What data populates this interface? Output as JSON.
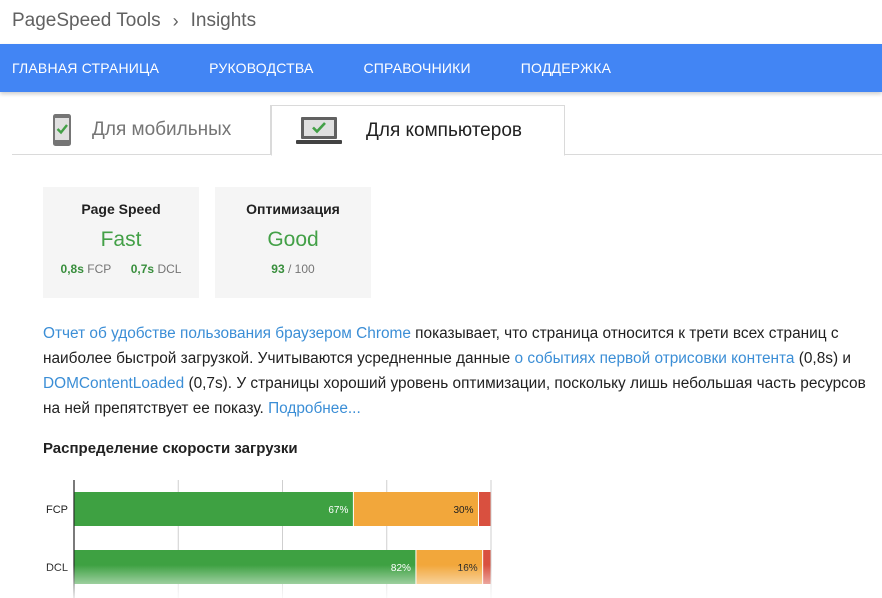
{
  "breadcrumb": {
    "root": "PageSpeed Tools",
    "current": "Insights"
  },
  "nav": {
    "items": [
      {
        "label": "ГЛАВНАЯ СТРАНИЦА"
      },
      {
        "label": "РУКОВОДСТВА"
      },
      {
        "label": "СПРАВОЧНИКИ"
      },
      {
        "label": "ПОДДЕРЖКА"
      }
    ]
  },
  "tabs": {
    "mobile": {
      "label": "Для мобильных",
      "icon": "mobile-phone-icon",
      "selected": false
    },
    "desktop": {
      "label": "Для компьютеров",
      "icon": "desktop-monitor-icon",
      "selected": true
    }
  },
  "cards": {
    "speed": {
      "title": "Page Speed",
      "value": "Fast",
      "fcp_value": "0,8s",
      "fcp_label": "FCP",
      "dcl_value": "0,7s",
      "dcl_label": "DCL"
    },
    "optimization": {
      "title": "Оптимизация",
      "value": "Good",
      "score": "93",
      "max": "/ 100"
    }
  },
  "description": {
    "link1": "Отчет об удобстве пользования браузером Chrome",
    "text1": " показывает, что страница относится к трети всех страниц с наиболее быстрой загрузкой. Учитываются усредненные данные ",
    "link2": "о событиях первой отрисовки контента",
    "text2": " (0,8s) и ",
    "link3": "DOMContentLoaded",
    "text3": " (0,7s). У страницы хороший уровень оптимизации, поскольку лишь небольшая часть ресурсов на ней препятствует ее показу. ",
    "link4": "Подробнее..."
  },
  "distribution": {
    "title": "Распределение скорости загрузки"
  },
  "colors": {
    "brand_blue": "#4285f4",
    "good_green": "#43a047",
    "bar_fast": "#3ea142",
    "bar_average": "#f2a73b",
    "bar_slow": "#d9503f",
    "link": "#3b8ed6"
  },
  "chart_data": {
    "type": "bar",
    "orientation": "horizontal",
    "stacked": true,
    "categories": [
      "FCP",
      "DCL"
    ],
    "series": [
      {
        "values": [
          67,
          82
        ],
        "labels": [
          "67%",
          "82%"
        ],
        "color": "#3ea142"
      },
      {
        "values": [
          30,
          16
        ],
        "labels": [
          "30%",
          "16%"
        ],
        "color": "#f2a73b"
      },
      {
        "values": [
          3,
          2
        ],
        "labels": [
          "",
          ""
        ],
        "color": "#d9503f"
      }
    ],
    "xlim": [
      0,
      100
    ],
    "grid": true
  }
}
